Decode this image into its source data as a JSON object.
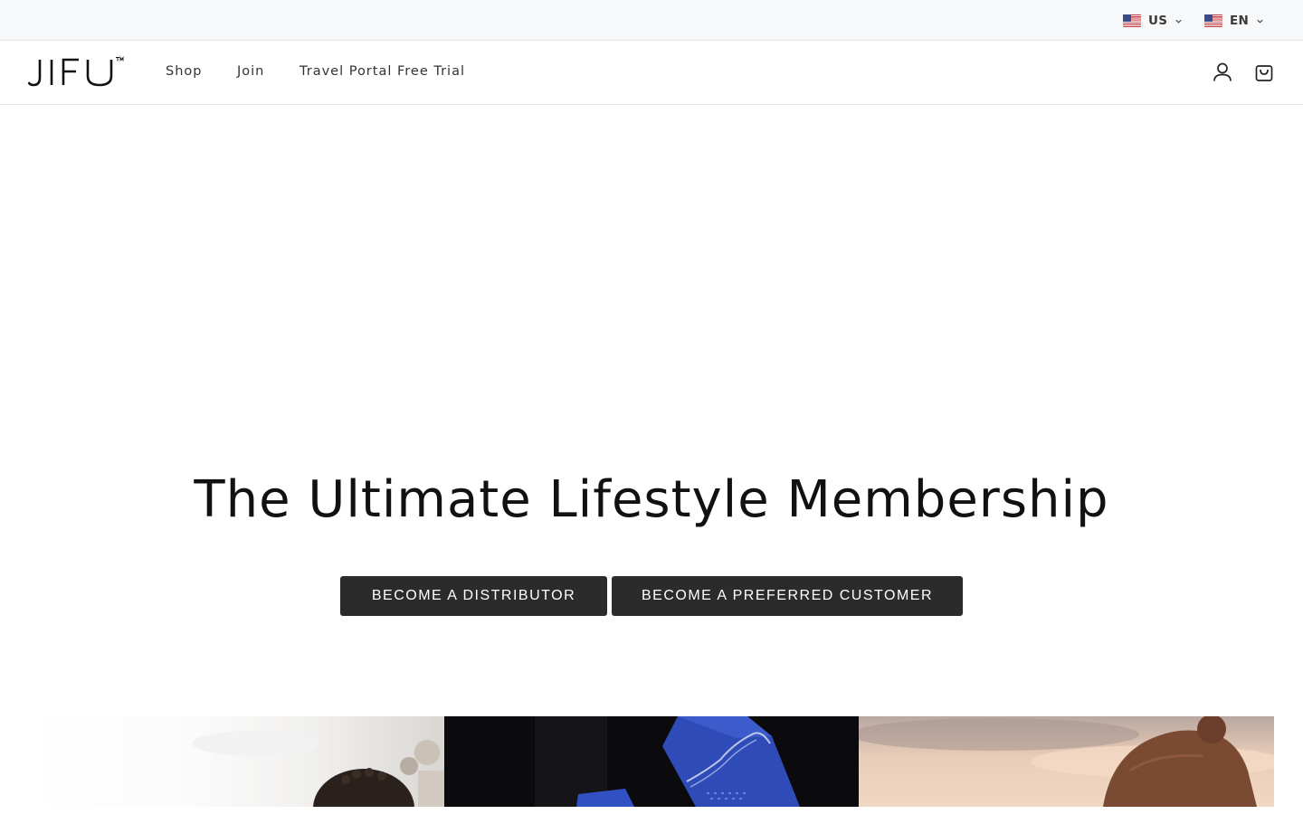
{
  "topbar": {
    "country": {
      "label": "US",
      "flag": "us-flag-icon"
    },
    "language": {
      "label": "EN",
      "flag": "us-flag-icon"
    }
  },
  "nav": {
    "logo_text": "JIFU",
    "links": [
      {
        "label": "Shop"
      },
      {
        "label": "Join"
      },
      {
        "label": "Travel Portal Free Trial"
      }
    ],
    "icons": [
      "account-icon",
      "cart-icon"
    ]
  },
  "hero": {
    "title": "The Ultimate Lifestyle Membership",
    "buttons": {
      "distributor": "BECOME A DISTRIBUTOR",
      "customer": "BECOME A PREFERRED CUSTOMER"
    }
  },
  "tiles": [
    {
      "image": "people-outdoors-photo"
    },
    {
      "image": "blue-cards-photo"
    },
    {
      "image": "sunset-person-photo"
    }
  ],
  "colors": {
    "button_bg": "#2b2b2b",
    "topbar_bg": "#f7f8fa",
    "text": "#111111"
  }
}
